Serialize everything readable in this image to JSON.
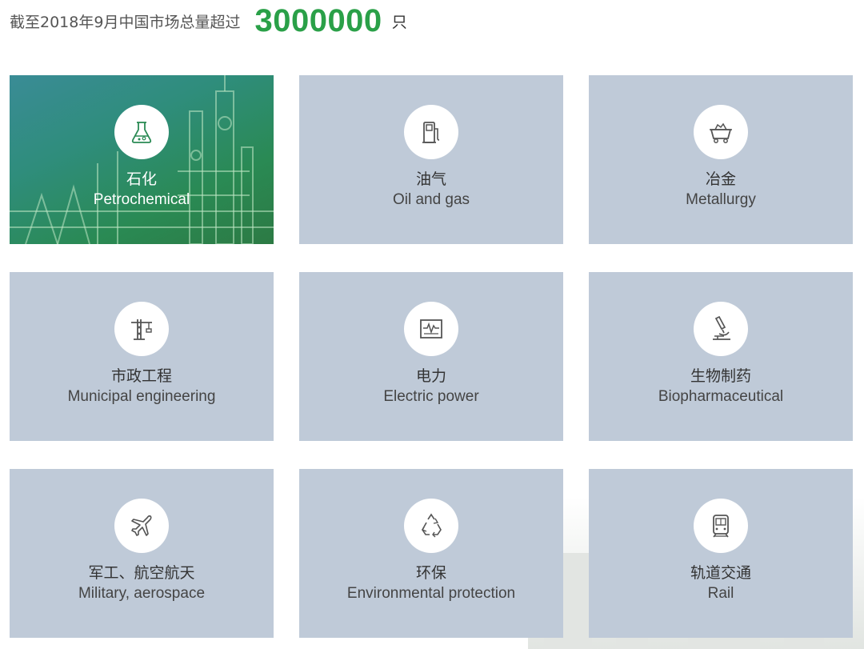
{
  "header": {
    "prefix": "截至2018年9月中国市场总量超过",
    "number": "3000000",
    "unit": "只"
  },
  "colors": {
    "accent_green": "#2aa048",
    "card_bg": "#bfcad8",
    "icon_stroke": "#555555",
    "active_green": "#2a8a54"
  },
  "cards": [
    {
      "cn": "石化",
      "en": "Petrochemical",
      "icon": "flask-icon",
      "active": true
    },
    {
      "cn": "油气",
      "en": "Oil and gas",
      "icon": "fuel-pump-icon",
      "active": false
    },
    {
      "cn": "冶金",
      "en": "Metallurgy",
      "icon": "mine-cart-icon",
      "active": false
    },
    {
      "cn": "市政工程",
      "en": "Municipal engineering",
      "icon": "crane-icon",
      "active": false
    },
    {
      "cn": "电力",
      "en": "Electric power",
      "icon": "power-monitor-icon",
      "active": false
    },
    {
      "cn": "生物制药",
      "en": "Biopharmaceutical",
      "icon": "microscope-icon",
      "active": false
    },
    {
      "cn": "军工、航空航天",
      "en": "Military, aerospace",
      "icon": "airplane-icon",
      "active": false
    },
    {
      "cn": "环保",
      "en": "Environmental protection",
      "icon": "recycle-icon",
      "active": false
    },
    {
      "cn": "轨道交通",
      "en": "Rail",
      "icon": "train-icon",
      "active": false
    }
  ]
}
